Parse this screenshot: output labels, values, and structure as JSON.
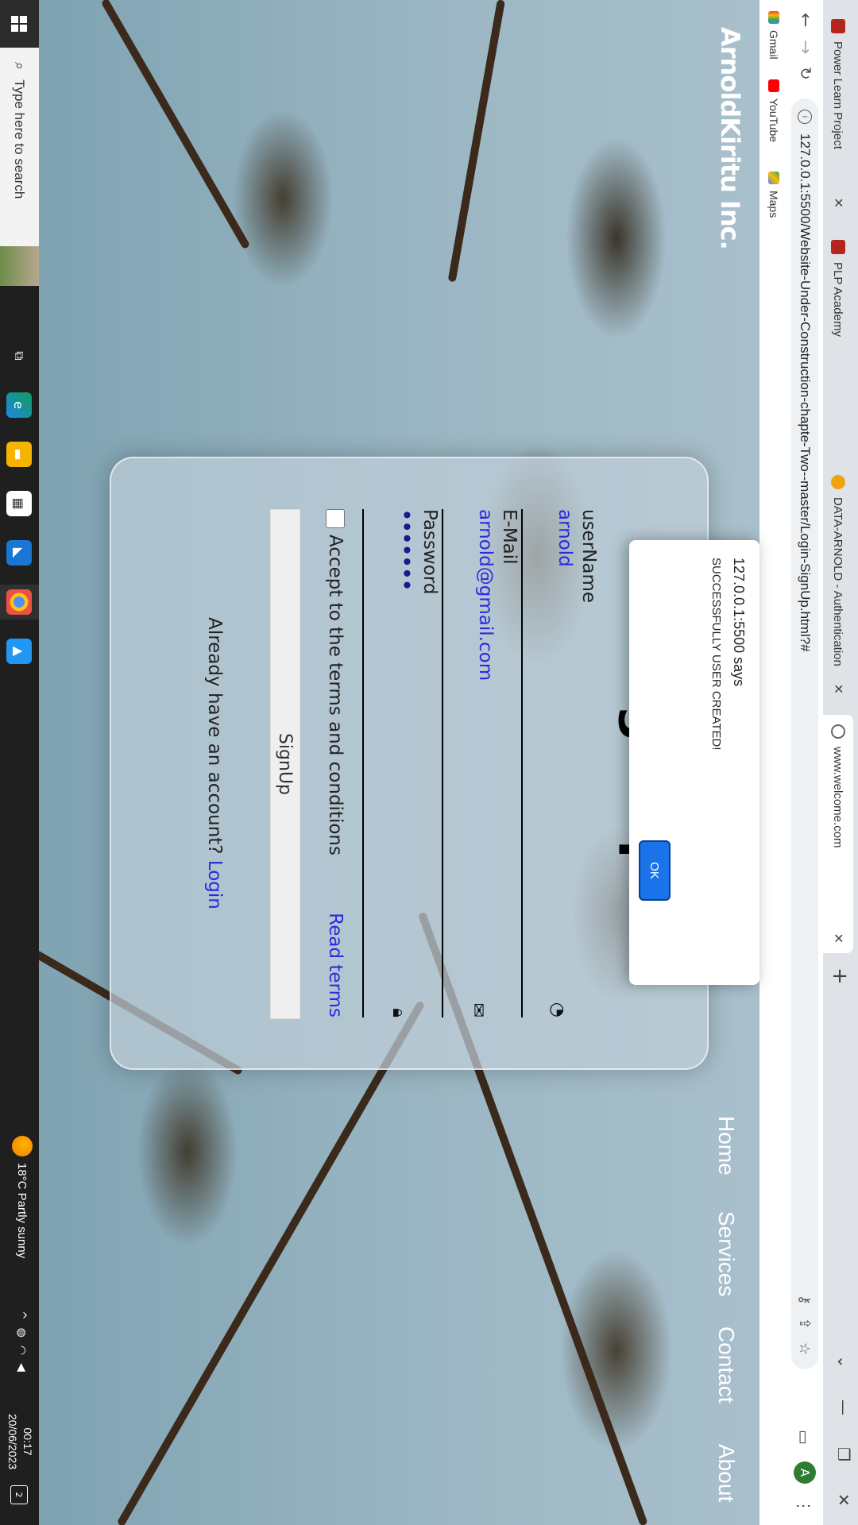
{
  "browser": {
    "tabs": [
      {
        "title": "Power Learn Project",
        "favicon_color": "#b3261e"
      },
      {
        "title": "PLP Academy",
        "favicon_color": "#b3261e"
      },
      {
        "title": "DATA-ARNOLD - Authentication",
        "favicon_color": "#f2a20b"
      },
      {
        "title": "www.welcome.com",
        "favicon_color": "#666666"
      }
    ],
    "address": "127.0.0.1:5500/Website-Under-Construction-chapte-Two--master/Login-SignUp.html?#",
    "bookmarks": [
      "Gmail",
      "YouTube",
      "Maps"
    ],
    "profile_initial": "A"
  },
  "page": {
    "brand": "ArnoldKiritu Inc.",
    "nav": [
      "Home",
      "Services",
      "Contact",
      "About"
    ]
  },
  "form": {
    "title": "Sign Up",
    "username_label": "userName",
    "username_value": "arnold",
    "email_label": "E-Mail",
    "email_value": "arnold@gmail.com",
    "password_label": "Password",
    "password_value": "•••••••",
    "terms_label": "Accept to the terms and conditions",
    "read_terms": "Read terms",
    "signup_button": "SignUp",
    "have_account": "Already have an account? ",
    "login_link": "Login"
  },
  "dialog": {
    "title": "127.0.0.1:5500 says",
    "message": "SUCCESSFULLY USER CREATED!",
    "ok": "OK"
  },
  "taskbar": {
    "search_placeholder": "Type here to search",
    "weather": "18°C  Partly sunny",
    "time": "00:17",
    "date": "20/06/2023",
    "notification_count": "2"
  }
}
